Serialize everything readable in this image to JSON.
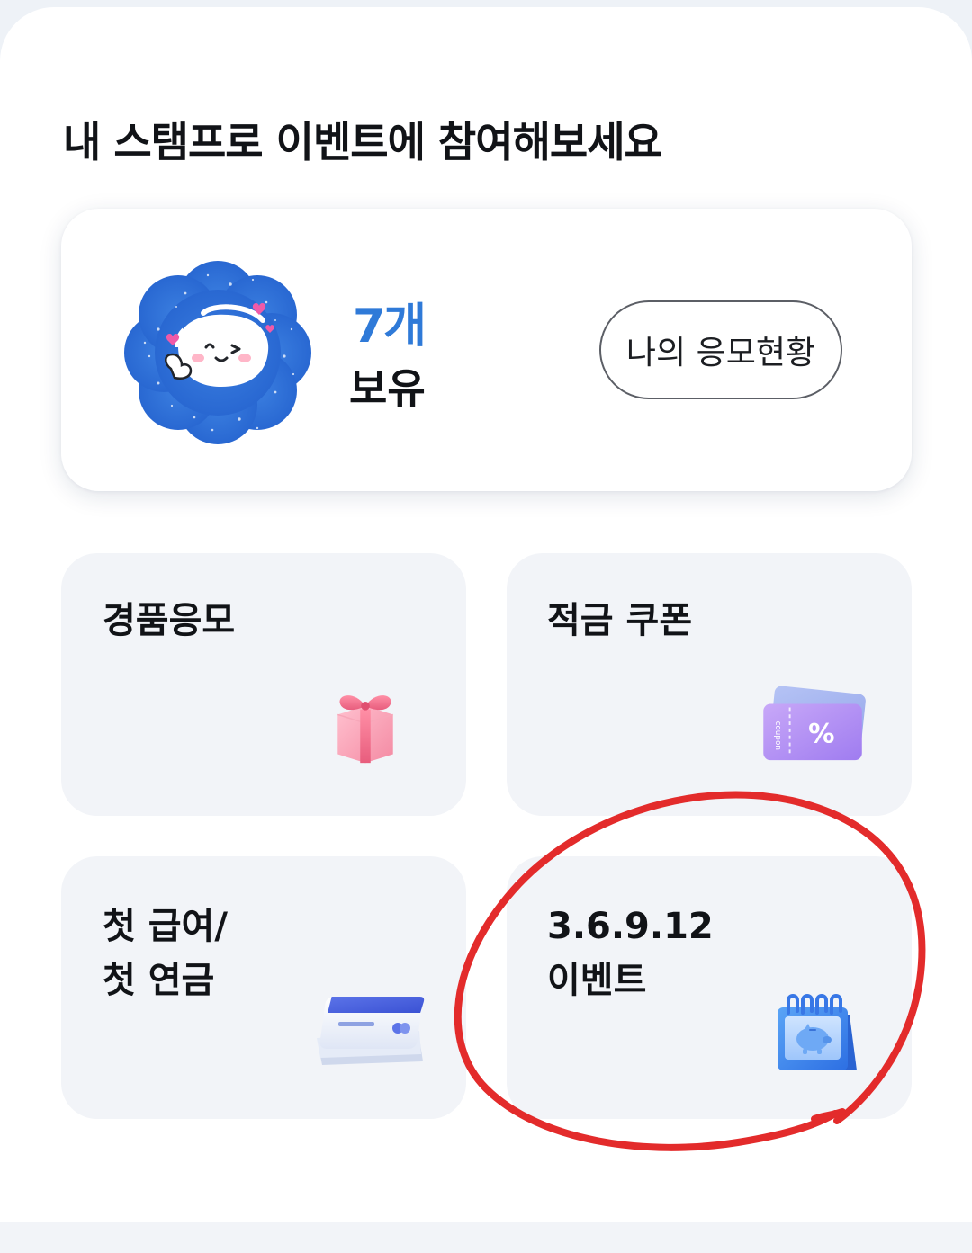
{
  "header": {
    "title": "내 스탬프로 이벤트에 참여해보세요"
  },
  "stamp": {
    "count": "7개",
    "owned_label": "보유",
    "entry_button_label": "나의 응모현황"
  },
  "menu": {
    "items": [
      {
        "label": "경품응모",
        "icon": "gift-icon"
      },
      {
        "label": "적금 쿠폰",
        "icon": "coupon-icon"
      },
      {
        "label_line1": "첫 급여/",
        "label_line2": "첫 연금",
        "icon": "card-icon"
      },
      {
        "label_line1": "3.6.9.12",
        "label_line2": "이벤트",
        "icon": "calendar-piggy-icon"
      }
    ]
  },
  "icons": {
    "coupon_percent": "%",
    "coupon_side_text": "coupon"
  },
  "colors": {
    "accent": "#2f7ad8",
    "annotation": "#e32b2b",
    "tile_background": "#f2f4f8"
  }
}
